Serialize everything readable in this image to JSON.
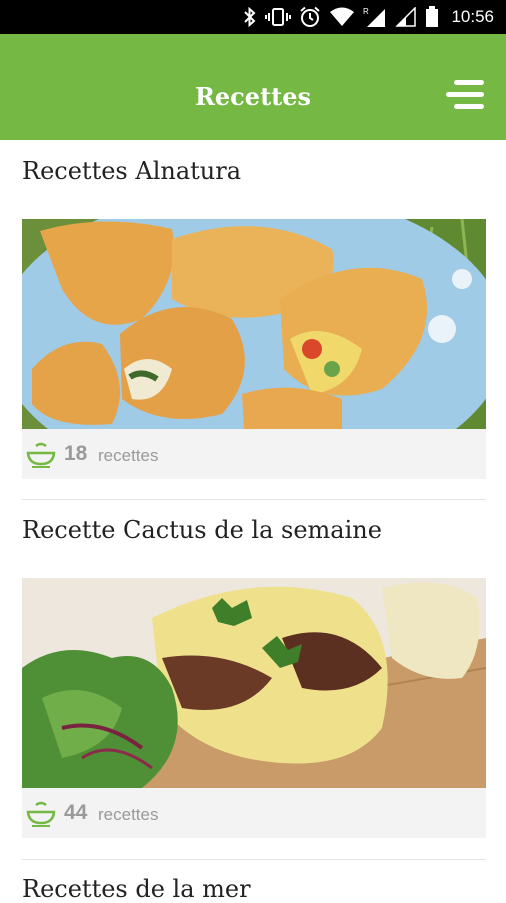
{
  "status_bar": {
    "time": "10:56",
    "icons": [
      "bluetooth-icon",
      "vibrate-icon",
      "alarm-icon",
      "wifi-icon",
      "signal-r-icon",
      "signal-icon",
      "battery-icon"
    ]
  },
  "app_bar": {
    "title": "Recettes",
    "menu_icon": "menu-icon"
  },
  "colors": {
    "accent": "#75b843",
    "footer_bg": "#f3f3f3",
    "muted_text": "#9a9a9a"
  },
  "sections": [
    {
      "title": "Recettes Alnatura",
      "count": "18",
      "count_label": "recettes",
      "image": "empanadas-photo"
    },
    {
      "title": "Recette Cactus de la semaine",
      "count": "44",
      "count_label": "recettes",
      "image": "gratin-salad-photo"
    },
    {
      "title": "Recettes de la mer"
    }
  ]
}
